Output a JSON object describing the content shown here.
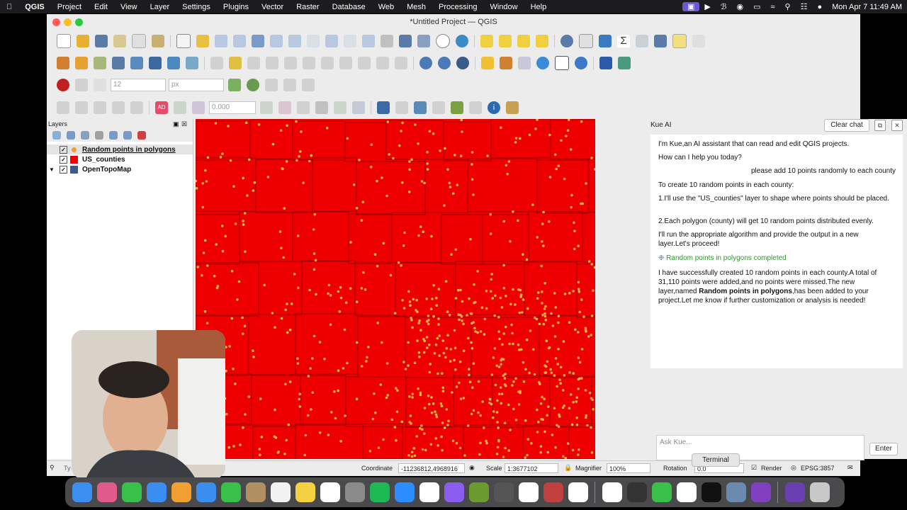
{
  "menubar": {
    "app_name": "QGIS",
    "items": [
      "Project",
      "Edit",
      "View",
      "Layer",
      "Settings",
      "Plugins",
      "Vector",
      "Raster",
      "Database",
      "Web",
      "Mesh",
      "Processing",
      "Window",
      "Help"
    ],
    "clock": "Mon Apr 7  11:49 AM"
  },
  "window": {
    "title": "*Untitled Project — QGIS"
  },
  "toolbar": {
    "font_size_value": "12",
    "unit_value": "px",
    "buffer_value": "0.000"
  },
  "layers_panel": {
    "title": "Layers",
    "layers": [
      {
        "name": "Random points in polygons",
        "checked": true,
        "swatch": "#f0a030"
      },
      {
        "name": "US_counties",
        "checked": true,
        "swatch": "#ee0000"
      },
      {
        "name": "OpenTopoMap",
        "checked": true,
        "swatch": "#3a5a8a"
      }
    ]
  },
  "kue_panel": {
    "title": "Kue AI",
    "clear_label": "Clear chat",
    "messages": {
      "intro": "I'm Kue,an AI assistant that can read and edit QGIS projects.",
      "help": "How can I help you today?",
      "user": "please add 10 points randomly to each county",
      "plan_head": "To create 10 random points in each county:",
      "step1": "1.I'll use the \"US_counties\" layer to shape where points should be placed.",
      "step2": "2.Each polygon (county) will get 10 random points distributed evenly.",
      "run": "I'll run the appropriate algorithm and provide the output in a new layer.Let's proceed!",
      "status": "Random points in polygons completed",
      "result_a": "I have successfully created 10 random points in each county.A total of 31,110 points were added,and no points were missed.The new layer,named ",
      "result_bold": "Random points in polygons",
      "result_b": ",has been added to your project.Let me know if further customization or analysis is needed!"
    },
    "input_placeholder": "Ask Kue...",
    "enter_label": "Enter",
    "status_color": "#2a9a2a"
  },
  "statusbar": {
    "search_placeholder": "Ty",
    "coordinate_label": "Coordinate",
    "coordinate_value": "-11236812,4968916",
    "scale_label": "Scale",
    "scale_value": "1:3677102",
    "magnifier_label": "Magnifier",
    "magnifier_value": "100%",
    "rotation_label": "Rotation",
    "rotation_value": "0.0",
    "render_label": "Render",
    "crs_label": "EPSG:3857"
  },
  "tooltip": "Terminal",
  "map": {
    "fill_color": "#ee0000",
    "point_color": "#f2b040",
    "border_color": "#9a0000"
  },
  "dock": {
    "apps": [
      {
        "name": "finder",
        "color": "#3b8ff0"
      },
      {
        "name": "launchpad",
        "color": "#e05a8a"
      },
      {
        "name": "messages",
        "color": "#38c04a"
      },
      {
        "name": "safari",
        "color": "#3a8ef0"
      },
      {
        "name": "photos",
        "color": "#f0a030"
      },
      {
        "name": "app-store",
        "color": "#3a8ef0"
      },
      {
        "name": "facetime",
        "color": "#38c04a"
      },
      {
        "name": "archive",
        "color": "#b09060"
      },
      {
        "name": "reminders",
        "color": "#f2f2f2"
      },
      {
        "name": "notes",
        "color": "#f5d040"
      },
      {
        "name": "freeform",
        "color": "#ffffff"
      },
      {
        "name": "system-settings",
        "color": "#8a8a8a"
      },
      {
        "name": "spotify",
        "color": "#1db954"
      },
      {
        "name": "zoom",
        "color": "#2d8cff"
      },
      {
        "name": "slack",
        "color": "#ffffff"
      },
      {
        "name": "messenger",
        "color": "#8a5cf0"
      },
      {
        "name": "qgis",
        "color": "#6a9a30"
      },
      {
        "name": "calculator",
        "color": "#555555"
      },
      {
        "name": "notion",
        "color": "#ffffff"
      },
      {
        "name": "document",
        "color": "#c04040"
      },
      {
        "name": "github",
        "color": "#ffffff"
      },
      {
        "name": "bulb",
        "color": "#ffffff"
      },
      {
        "name": "app-dark",
        "color": "#333333"
      },
      {
        "name": "numbers",
        "color": "#38c04a"
      },
      {
        "name": "chatgpt",
        "color": "#ffffff"
      },
      {
        "name": "terminal",
        "color": "#111111"
      },
      {
        "name": "preview",
        "color": "#6a8ab0"
      },
      {
        "name": "obs",
        "color": "#8040c0"
      },
      {
        "name": "screen-app",
        "color": "#6a40b0"
      },
      {
        "name": "trash",
        "color": "#c8c8c8"
      }
    ]
  }
}
